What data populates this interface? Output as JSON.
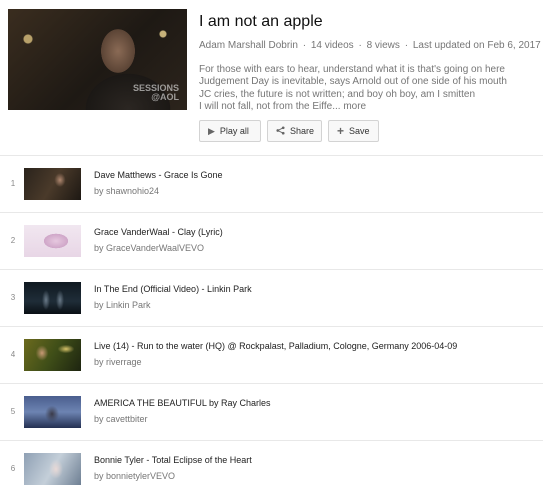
{
  "playlist": {
    "title": "I am not an apple",
    "owner": "Adam Marshall Dobrin",
    "video_count": "14 videos",
    "views": "8 views",
    "updated": "Last updated on Feb 6, 2017",
    "thumb_watermark_line1": "SESSIONS",
    "thumb_watermark_line2": "@AOL",
    "description_lines": [
      "For those with ears to hear, understand what it is that's going on here",
      "Judgement Day is inevitable, says Arnold out of one side of his mouth",
      "JC cries, the future is not written; and boy oh boy, am I smitten",
      "I will not fall, not from the Eiffe..."
    ],
    "more_label": "more",
    "separator": "·"
  },
  "actions": {
    "play_all": "Play all",
    "share": "Share",
    "save": "Save"
  },
  "videos": [
    {
      "index": "1",
      "title": "Dave Matthews - Grace Is Gone",
      "owner": "by shawnohio24"
    },
    {
      "index": "2",
      "title": "Grace VanderWaal - Clay (Lyric)",
      "owner": "by GraceVanderWaalVEVO"
    },
    {
      "index": "3",
      "title": "In The End (Official Video) - Linkin Park",
      "owner": "by Linkin Park"
    },
    {
      "index": "4",
      "title": "Live (14) - Run to the water (HQ) @ Rockpalast, Palladium, Cologne, Germany 2006-04-09",
      "owner": "by riverrage"
    },
    {
      "index": "5",
      "title": "AMERICA THE BEAUTIFUL by Ray Charles",
      "owner": "by cavettbiter"
    },
    {
      "index": "6",
      "title": "Bonnie Tyler - Total Eclipse of the Heart",
      "owner": "by bonnietylerVEVO"
    }
  ]
}
